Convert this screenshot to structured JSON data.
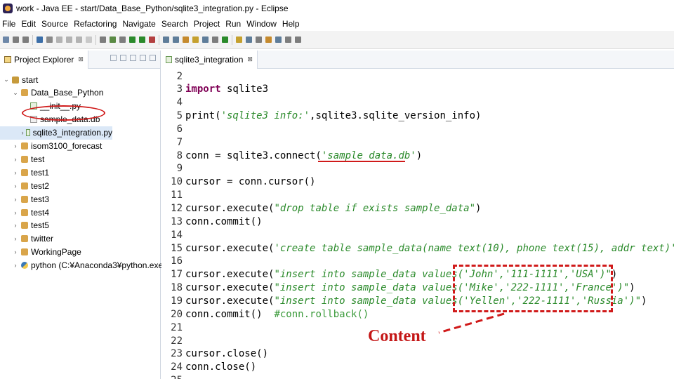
{
  "window": {
    "title": "work - Java EE - start/Data_Base_Python/sqlite3_integration.py - Eclipse"
  },
  "menu": [
    "File",
    "Edit",
    "Source",
    "Refactoring",
    "Navigate",
    "Search",
    "Project",
    "Run",
    "Window",
    "Help"
  ],
  "toolbar": {
    "icon_colors": [
      "#6d87a8",
      "#7d7d7d",
      "#7d7d7d",
      "#3b6ea8",
      "#8a8a8a",
      "#b3b3b3",
      "#b3b3b3",
      "#b3b3b3",
      "#c9c9c9",
      "#7d7d7d",
      "#5a8a44",
      "#7d7d7d",
      "#2b8a2b",
      "#2b8a2b",
      "#b34040",
      "#5f7d99",
      "#5f7d99",
      "#c58a2e",
      "#c5a02e",
      "#5f7d99",
      "#7d7d7d",
      "#2b8a2b",
      "#c5a02e",
      "#5f7d99",
      "#7d7d7d",
      "#c58a2e",
      "#5f7d99",
      "#7d7d7d",
      "#7d7d7d"
    ]
  },
  "explorer": {
    "tab_label": "Project Explorer",
    "tab_close": "⊠",
    "tree": [
      {
        "label": "start",
        "twisty": "⌄",
        "icon": "project",
        "indent": 0
      },
      {
        "label": "Data_Base_Python",
        "twisty": "⌄",
        "icon": "package",
        "indent": 1
      },
      {
        "label": "__init__.py",
        "twisty": "",
        "icon": "py",
        "indent": 2
      },
      {
        "label": "sample_data.db",
        "twisty": "",
        "icon": "db",
        "indent": 2
      },
      {
        "label": "sqlite3_integration.py",
        "twisty": "›",
        "icon": "py",
        "indent": 2,
        "selected": true
      },
      {
        "label": "isom3100_forecast",
        "twisty": "›",
        "icon": "package",
        "indent": 1
      },
      {
        "label": "test",
        "twisty": "›",
        "icon": "package",
        "indent": 1
      },
      {
        "label": "test1",
        "twisty": "›",
        "icon": "package",
        "indent": 1
      },
      {
        "label": "test2",
        "twisty": "›",
        "icon": "package",
        "indent": 1
      },
      {
        "label": "test3",
        "twisty": "›",
        "icon": "package",
        "indent": 1
      },
      {
        "label": "test4",
        "twisty": "›",
        "icon": "package",
        "indent": 1
      },
      {
        "label": "test5",
        "twisty": "›",
        "icon": "package",
        "indent": 1
      },
      {
        "label": "twitter",
        "twisty": "›",
        "icon": "package",
        "indent": 1
      },
      {
        "label": "WorkingPage",
        "twisty": "›",
        "icon": "package",
        "indent": 1
      },
      {
        "label": "python  (C:¥Anaconda3¥python.exe)",
        "twisty": "›",
        "icon": "python-interpreter",
        "indent": 1
      }
    ]
  },
  "editor": {
    "tab_label": "sqlite3_integration",
    "tab_close": "⊠",
    "lines": [
      {
        "n": "2",
        "segments": []
      },
      {
        "n": "3",
        "segments": [
          {
            "t": "import",
            "c": "kw"
          },
          {
            "t": " sqlite3",
            "c": "code"
          }
        ]
      },
      {
        "n": "4",
        "segments": []
      },
      {
        "n": "5",
        "segments": [
          {
            "t": "print(",
            "c": "code"
          },
          {
            "t": "'sqlite3 info:'",
            "c": "str"
          },
          {
            "t": ",sqlite3.sqlite_version_info)",
            "c": "code"
          }
        ]
      },
      {
        "n": "6",
        "segments": []
      },
      {
        "n": "7",
        "segments": []
      },
      {
        "n": "8",
        "segments": [
          {
            "t": "conn = sqlite3.connect(",
            "c": "code"
          },
          {
            "t": "'sample_data.db'",
            "c": "str"
          },
          {
            "t": ")",
            "c": "code"
          }
        ]
      },
      {
        "n": "9",
        "segments": []
      },
      {
        "n": "10",
        "segments": [
          {
            "t": "cursor = conn.cursor()",
            "c": "code"
          }
        ]
      },
      {
        "n": "11",
        "segments": []
      },
      {
        "n": "12",
        "segments": [
          {
            "t": "cursor.execute(",
            "c": "code"
          },
          {
            "t": "\"drop table if exists sample_data\"",
            "c": "str"
          },
          {
            "t": ")",
            "c": "code"
          }
        ]
      },
      {
        "n": "13",
        "segments": [
          {
            "t": "conn.commit()",
            "c": "code"
          }
        ]
      },
      {
        "n": "14",
        "segments": []
      },
      {
        "n": "15",
        "segments": [
          {
            "t": "cursor.execute(",
            "c": "code"
          },
          {
            "t": "'create table sample_data(name text(10), phone text(15), addr text)'",
            "c": "str"
          },
          {
            "t": ")",
            "c": "code"
          }
        ]
      },
      {
        "n": "16",
        "segments": []
      },
      {
        "n": "17",
        "segments": [
          {
            "t": "cursor.execute(",
            "c": "code"
          },
          {
            "t": "\"insert into sample_data values('John','111-1111','USA')\"",
            "c": "str"
          },
          {
            "t": ")",
            "c": "code"
          }
        ]
      },
      {
        "n": "18",
        "segments": [
          {
            "t": "cursor.execute(",
            "c": "code"
          },
          {
            "t": "\"insert into sample_data values('Mike','222-1111','France')\"",
            "c": "str"
          },
          {
            "t": ")",
            "c": "code"
          }
        ]
      },
      {
        "n": "19",
        "segments": [
          {
            "t": "cursor.execute(",
            "c": "code"
          },
          {
            "t": "\"insert into sample_data values('Yellen','222-1111','Russia')\"",
            "c": "str"
          },
          {
            "t": ")",
            "c": "code"
          }
        ]
      },
      {
        "n": "20",
        "segments": [
          {
            "t": "conn.commit()  ",
            "c": "code"
          },
          {
            "t": "#conn.rollback()",
            "c": "cmt"
          }
        ]
      },
      {
        "n": "21",
        "segments": []
      },
      {
        "n": "22",
        "segments": []
      },
      {
        "n": "23",
        "segments": [
          {
            "t": "cursor.close()",
            "c": "code"
          }
        ]
      },
      {
        "n": "24",
        "segments": [
          {
            "t": "conn.close()",
            "c": "code"
          }
        ]
      },
      {
        "n": "25",
        "segments": []
      }
    ]
  },
  "annotation": {
    "label": "Content",
    "color": "#d01a1a"
  }
}
